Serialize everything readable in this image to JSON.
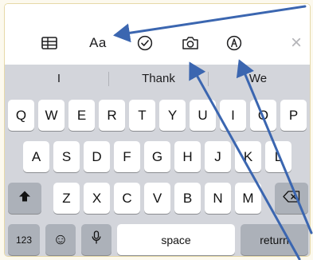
{
  "toolbar": {
    "format_label": "Aa",
    "close_glyph": "×",
    "icons": [
      "table-icon",
      "format-icon",
      "checklist-icon",
      "camera-icon",
      "markup-icon",
      "close-icon"
    ]
  },
  "suggestions": [
    "I",
    "Thank",
    "We"
  ],
  "keyboard": {
    "row1": [
      "Q",
      "W",
      "E",
      "R",
      "T",
      "Y",
      "U",
      "I",
      "O",
      "P"
    ],
    "row2": [
      "A",
      "S",
      "D",
      "F",
      "G",
      "H",
      "J",
      "K",
      "L"
    ],
    "row3": [
      "Z",
      "X",
      "C",
      "V",
      "B",
      "N",
      "M"
    ],
    "numbers_label": "123",
    "space_label": "space",
    "return_label": "return",
    "emoji_glyph": "☺"
  },
  "colors": {
    "arrow": "#3b66b0",
    "keyboard_bg": "#d3d5db",
    "key_dark": "#acb1b9"
  }
}
